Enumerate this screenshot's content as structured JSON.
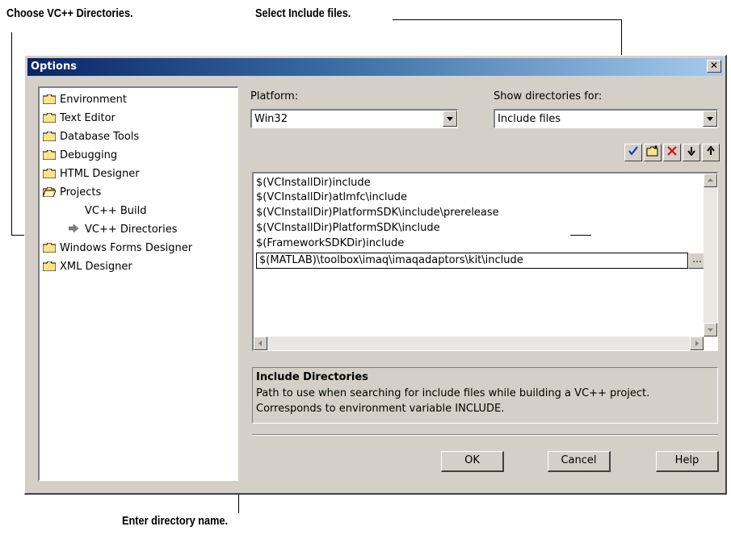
{
  "callouts": {
    "choose": "Choose VC++ Directories.",
    "select": "Select Include files.",
    "enter": "Enter directory name."
  },
  "dialog": {
    "title": "Options",
    "close_label": "✕",
    "tree": {
      "items": [
        {
          "label": "Environment",
          "icon": "folder-icon"
        },
        {
          "label": "Text Editor",
          "icon": "folder-icon"
        },
        {
          "label": "Database Tools",
          "icon": "folder-icon"
        },
        {
          "label": "Debugging",
          "icon": "folder-icon"
        },
        {
          "label": "HTML Designer",
          "icon": "folder-icon"
        },
        {
          "label": "Projects",
          "icon": "open-folder-icon"
        },
        {
          "label": "VC++ Build",
          "icon": ""
        },
        {
          "label": "VC++ Directories",
          "icon": "arrow-right-icon"
        },
        {
          "label": "Windows Forms Designer",
          "icon": "folder-icon"
        },
        {
          "label": "XML Designer",
          "icon": "folder-icon"
        }
      ]
    },
    "platform": {
      "label": "Platform:",
      "value": "Win32"
    },
    "show_dirs": {
      "label": "Show directories for:",
      "value": "Include files"
    },
    "toolbar": [
      "check-icon",
      "new-folder-icon",
      "delete-icon",
      "move-down-icon",
      "move-up-icon"
    ],
    "directories": [
      "$(VCInstallDir)include",
      "$(VCInstallDir)atlmfc\\include",
      "$(VCInstallDir)PlatformSDK\\include\\prerelease",
      "$(VCInstallDir)PlatformSDK\\include",
      "$(FrameworkSDKDir)include"
    ],
    "editing_entry": "$(MATLAB)\\toolbox\\imaq\\imaqadaptors\\kit\\include",
    "browse_label": "...",
    "description": {
      "heading": "Include Directories",
      "line1": "Path to use when searching for include files while building a VC++ project.",
      "line2": "Corresponds to environment variable INCLUDE."
    },
    "buttons": {
      "ok": "OK",
      "cancel": "Cancel",
      "help": "Help"
    }
  }
}
